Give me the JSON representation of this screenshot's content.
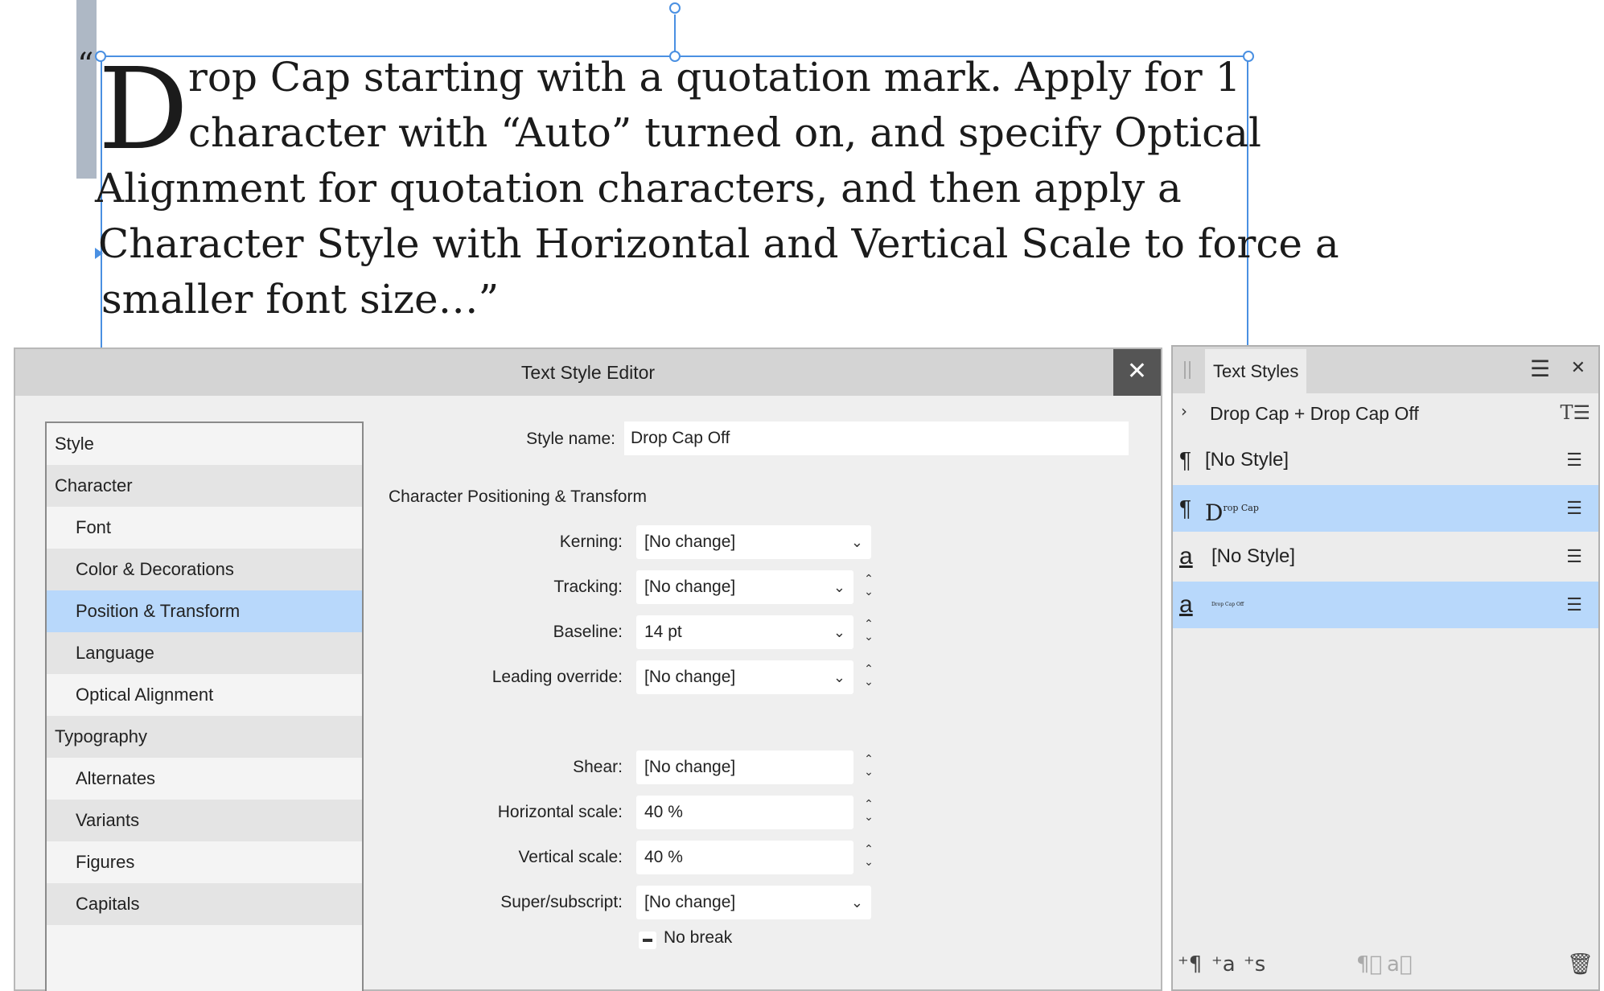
{
  "canvas": {
    "hang_quote": "“",
    "drop_cap": "D",
    "lines": [
      "rop Cap starting with a quotation mark. Apply for 1",
      "character with “Auto” turned on, and specify Optical",
      "Alignment for quotation characters, and then apply a",
      "Character Style with Horizontal and Vertical Scale to force a",
      "smaller font size…”"
    ]
  },
  "editor": {
    "title": "Text Style Editor",
    "close_glyph": "✕",
    "nav": [
      {
        "label": "Style",
        "level": 0
      },
      {
        "label": "Character",
        "level": 0
      },
      {
        "label": "Font",
        "level": 1
      },
      {
        "label": "Color & Decorations",
        "level": 1
      },
      {
        "label": "Position & Transform",
        "level": 1,
        "selected": true
      },
      {
        "label": "Language",
        "level": 1
      },
      {
        "label": "Optical Alignment",
        "level": 1
      },
      {
        "label": "Typography",
        "level": 0
      },
      {
        "label": "Alternates",
        "level": 1
      },
      {
        "label": "Variants",
        "level": 1
      },
      {
        "label": "Figures",
        "level": 1
      },
      {
        "label": "Capitals",
        "level": 1
      }
    ],
    "style_name_label": "Style name:",
    "style_name_value": "Drop Cap Off",
    "section_title": "Character Positioning & Transform",
    "fields": {
      "kerning": {
        "label": "Kerning:",
        "value": "[No change]"
      },
      "tracking": {
        "label": "Tracking:",
        "value": "[No change]"
      },
      "baseline": {
        "label": "Baseline:",
        "value": "14 pt"
      },
      "leading": {
        "label": "Leading override:",
        "value": "[No change]"
      },
      "shear": {
        "label": "Shear:",
        "value": "[No change]"
      },
      "hscale": {
        "label": "Horizontal scale:",
        "value": "40 %"
      },
      "vscale": {
        "label": "Vertical scale:",
        "value": "40 %"
      },
      "supersub": {
        "label": "Super/subscript:",
        "value": "[No change]"
      }
    },
    "no_break_label": "No break"
  },
  "panel": {
    "title": "Text Styles",
    "context": "Drop Cap + Drop Cap Off",
    "rows": [
      {
        "glyph": "¶",
        "label": "[No Style]"
      },
      {
        "glyph": "¶",
        "preview_big": "D",
        "preview_sup": "rop Cap"
      },
      {
        "glyph": "a",
        "label": "[No Style]"
      },
      {
        "glyph": "a",
        "preview_tiny": "Drop Cap Off"
      }
    ],
    "footer": {
      "new_para": "⁺¶",
      "new_char": "⁺a",
      "new_group": "⁺s"
    }
  }
}
